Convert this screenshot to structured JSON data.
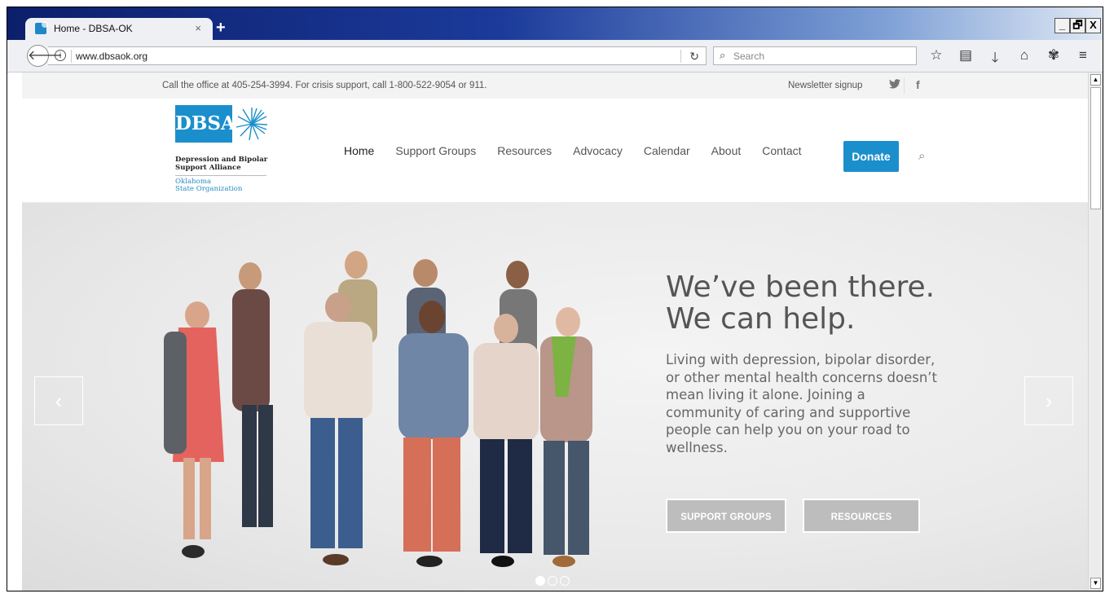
{
  "browser": {
    "tab_title": "Home - DBSA-OK",
    "tab_close": "×",
    "new_tab": "+",
    "url": "www.dbsaok.org",
    "search_placeholder": "Search",
    "window_controls": [
      "_",
      "🗗",
      "X"
    ],
    "toolbar_icons": [
      "star-icon",
      "reading-list-icon",
      "download-icon",
      "home-icon",
      "extension-icon",
      "menu-icon"
    ]
  },
  "site": {
    "topbar": {
      "text": "Call the office at 405-254-3994. For crisis support, call 1-800-522-9054 or 911.",
      "newsletter": "Newsletter signup",
      "twitter_glyph": "🐦",
      "facebook_glyph": "f"
    },
    "logo": {
      "mark": "DBSA",
      "line1": "Depression and Bipolar",
      "line2": "Support Alliance",
      "line3": "Oklahoma",
      "line4": "State Organization"
    },
    "nav": {
      "items": [
        "Home",
        "Support Groups",
        "Resources",
        "Advocacy",
        "Calendar",
        "About",
        "Contact"
      ],
      "donate": "Donate"
    },
    "hero": {
      "headline1": "We’ve been there.",
      "headline2": "We can help.",
      "body": "Living with depression, bipolar disorder, or other mental health concerns doesn’t mean living it alone. Joining a community of caring and supportive people can help you on your road to wellness.",
      "button1": "SUPPORT GROUPS",
      "button2": "RESOURCES",
      "prev": "‹",
      "next": "›",
      "slide_count": 3,
      "active_slide": 1
    }
  },
  "colors": {
    "brand_blue": "#1b8fcc",
    "hero_bg": "#e9e9e9",
    "hero_button": "#bdbdbd"
  }
}
